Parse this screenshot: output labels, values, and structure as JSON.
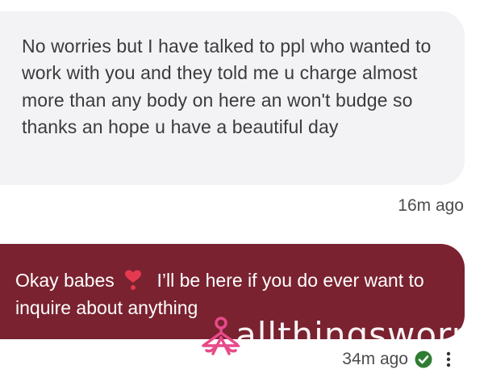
{
  "messages": [
    {
      "direction": "incoming",
      "text": "No worries but I have talked to ppl who wanted to work with you and they told me u charge almost more than any body on here an won't budge so thanks an hope u have a beautiful day",
      "time": "16m ago"
    },
    {
      "direction": "outgoing",
      "text_before_emoji": "Okay babes",
      "emoji": "heart-exclamation",
      "text_after_emoji": "I’ll be here if you do ever want to inquire about anything",
      "time": "34m ago",
      "status": "read-check-icon"
    }
  ],
  "watermark": {
    "text": "allthingsworn"
  },
  "colors": {
    "incoming_bubble": "#f3f2f4",
    "outgoing_bubble": "#7a2230",
    "check": "#2e7d32",
    "heart": "#e53950",
    "watermark_logo": "#e84a8a"
  }
}
